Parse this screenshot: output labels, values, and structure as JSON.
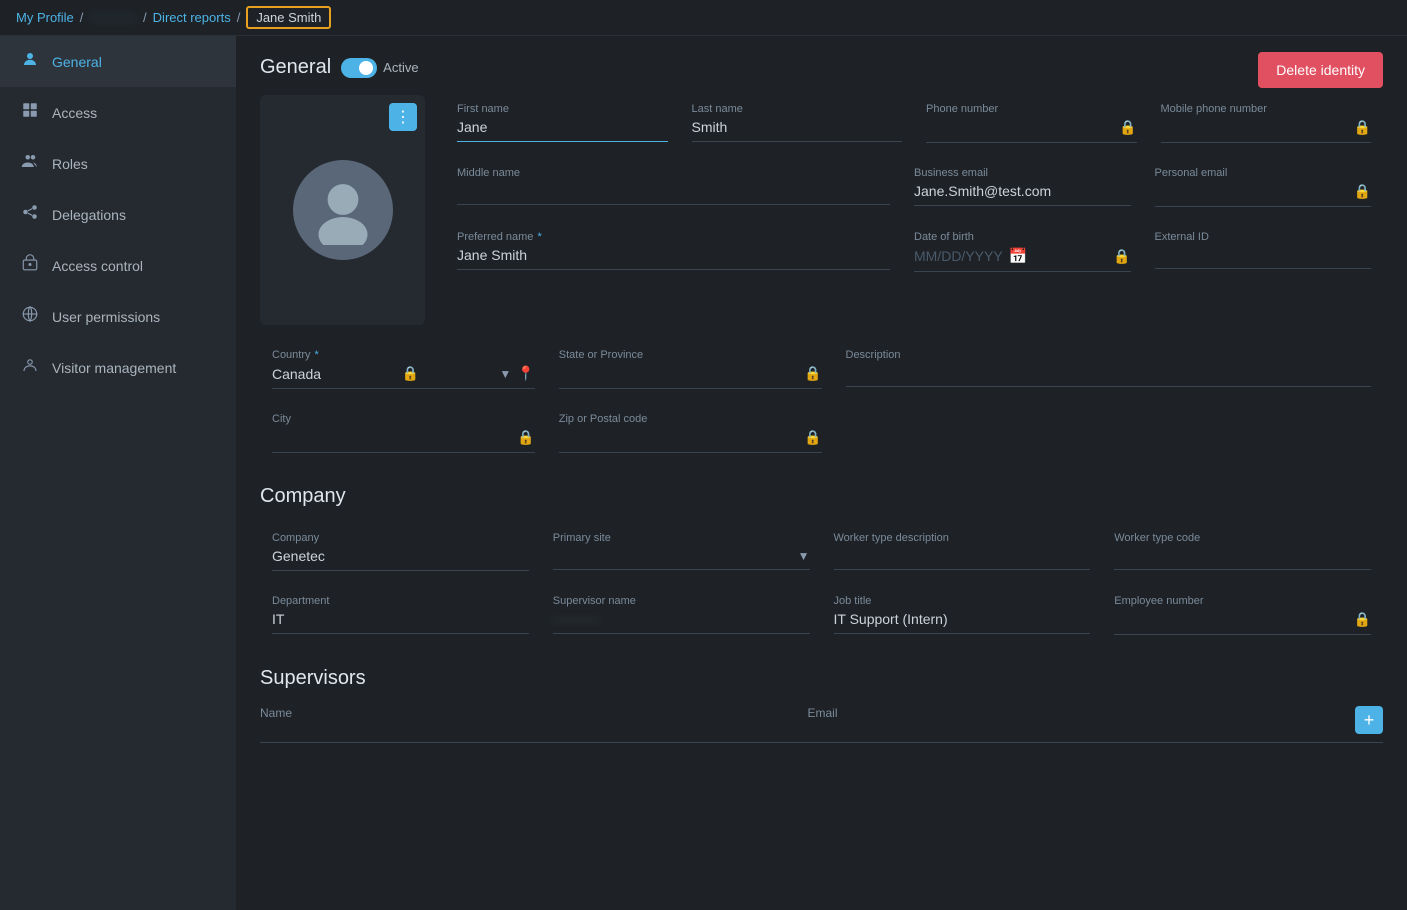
{
  "breadcrumb": {
    "my_profile": "My Profile",
    "blurred": "···········",
    "direct_reports": "Direct reports",
    "current": "Jane Smith"
  },
  "sidebar": {
    "items": [
      {
        "id": "general",
        "label": "General",
        "icon": "👤",
        "active": true
      },
      {
        "id": "access",
        "label": "Access",
        "icon": "🪪"
      },
      {
        "id": "roles",
        "label": "Roles",
        "icon": "👥"
      },
      {
        "id": "delegations",
        "label": "Delegations",
        "icon": "🔗"
      },
      {
        "id": "access-control",
        "label": "Access control",
        "icon": "📋"
      },
      {
        "id": "user-permissions",
        "label": "User permissions",
        "icon": "🌐"
      },
      {
        "id": "visitor-management",
        "label": "Visitor management",
        "icon": "👁"
      }
    ]
  },
  "header": {
    "title": "General",
    "status": "Active",
    "delete_btn": "Delete identity"
  },
  "general": {
    "first_name_label": "First name",
    "first_name_value": "Jane",
    "last_name_label": "Last name",
    "last_name_value": "Smith",
    "phone_label": "Phone number",
    "phone_value": "",
    "mobile_phone_label": "Mobile phone number",
    "mobile_phone_value": "",
    "middle_name_label": "Middle name",
    "middle_name_value": "",
    "business_email_label": "Business email",
    "business_email_value": "Jane.Smith@test.com",
    "personal_email_label": "Personal email",
    "personal_email_value": "",
    "preferred_name_label": "Preferred name",
    "preferred_name_required": "*",
    "preferred_name_value": "Jane Smith",
    "dob_label": "Date of birth",
    "dob_placeholder": "MM/DD/YYYY",
    "external_id_label": "External ID",
    "external_id_value": "",
    "country_label": "Country",
    "country_required": "*",
    "country_value": "Canada",
    "state_label": "State or Province",
    "state_value": "",
    "description_label": "Description",
    "description_value": "",
    "city_label": "City",
    "city_value": "",
    "zip_label": "Zip or Postal code",
    "zip_value": ""
  },
  "company": {
    "section_title": "Company",
    "company_label": "Company",
    "company_value": "Genetec",
    "primary_site_label": "Primary site",
    "primary_site_value": "",
    "worker_type_desc_label": "Worker type description",
    "worker_type_desc_value": "",
    "worker_type_code_label": "Worker type code",
    "worker_type_code_value": "",
    "department_label": "Department",
    "department_value": "IT",
    "supervisor_label": "Supervisor name",
    "supervisor_value": "··········",
    "job_title_label": "Job title",
    "job_title_value": "IT Support (Intern)",
    "employee_number_label": "Employee number",
    "employee_number_value": ""
  },
  "supervisors": {
    "section_title": "Supervisors",
    "name_col": "Name",
    "email_col": "Email",
    "add_btn": "+"
  }
}
